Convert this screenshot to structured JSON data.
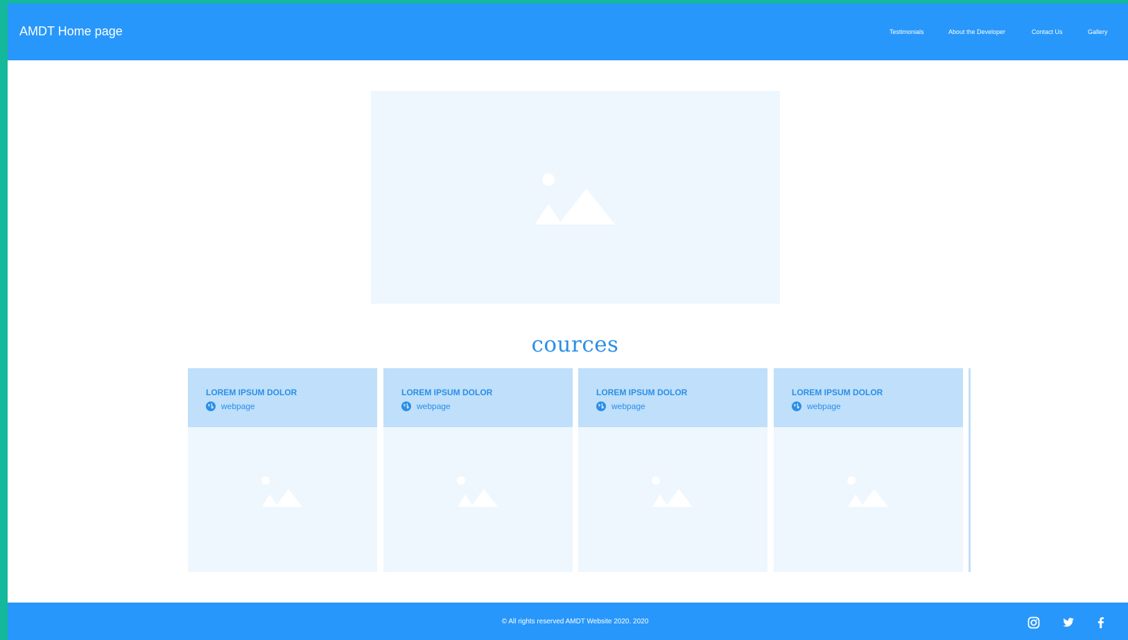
{
  "header": {
    "brand": "AMDT Home page",
    "nav": [
      {
        "label": "Testimonials"
      },
      {
        "label": "About the Developer"
      },
      {
        "label": "Contact Us"
      },
      {
        "label": "Gallery"
      }
    ]
  },
  "hero": {
    "icon": "image-placeholder-icon"
  },
  "courses": {
    "title": "cources",
    "cards": [
      {
        "title": "LOREM IPSUM DOLOR",
        "link": "webpage"
      },
      {
        "title": "LOREM IPSUM DOLOR",
        "link": "webpage"
      },
      {
        "title": "LOREM IPSUM DOLOR",
        "link": "webpage"
      },
      {
        "title": "LOREM IPSUM DOLOR",
        "link": "webpage"
      }
    ]
  },
  "footer": {
    "copyright": "© All rights reserved AMDT Website 2020. 2020",
    "social": [
      "instagram-icon",
      "twitter-icon",
      "facebook-icon"
    ]
  },
  "colors": {
    "accent": "#2897fb",
    "border": "#14b89a",
    "card_head": "#bfdffb",
    "placeholder": "#eef6fe",
    "text_accent": "#2a8fe6"
  }
}
